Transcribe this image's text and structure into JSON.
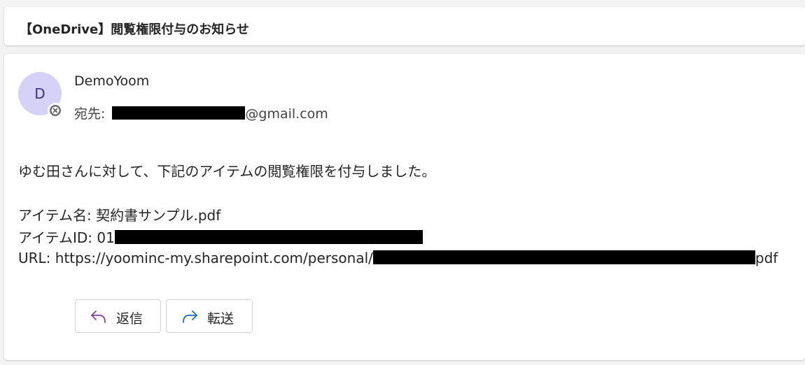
{
  "subject": "【OneDrive】閲覧権限付与のお知らせ",
  "sender": {
    "initial": "D",
    "name": "DemoYoom",
    "avatar_color": "#d6d2f7"
  },
  "recipient": {
    "label": "宛先:",
    "domain": "@gmail.com"
  },
  "body": {
    "line1": "ゆむ田さんに対して、下記のアイテムの閲覧権限を付与しました。",
    "item_name": "アイテム名: 契約書サンプル.pdf",
    "item_id_prefix": "アイテムID: 01",
    "url_prefix": "URL: https://yoominc-my.sharepoint.com/personal/",
    "url_suffix": "pdf"
  },
  "actions": {
    "reply_label": "返信",
    "forward_label": "転送",
    "reply_icon_color": "#8a3fa0",
    "forward_icon_color": "#1a73c9"
  },
  "icons": {
    "presence": "presence-blocked-icon",
    "reply": "reply-arrow-icon",
    "forward": "forward-arrow-icon"
  }
}
